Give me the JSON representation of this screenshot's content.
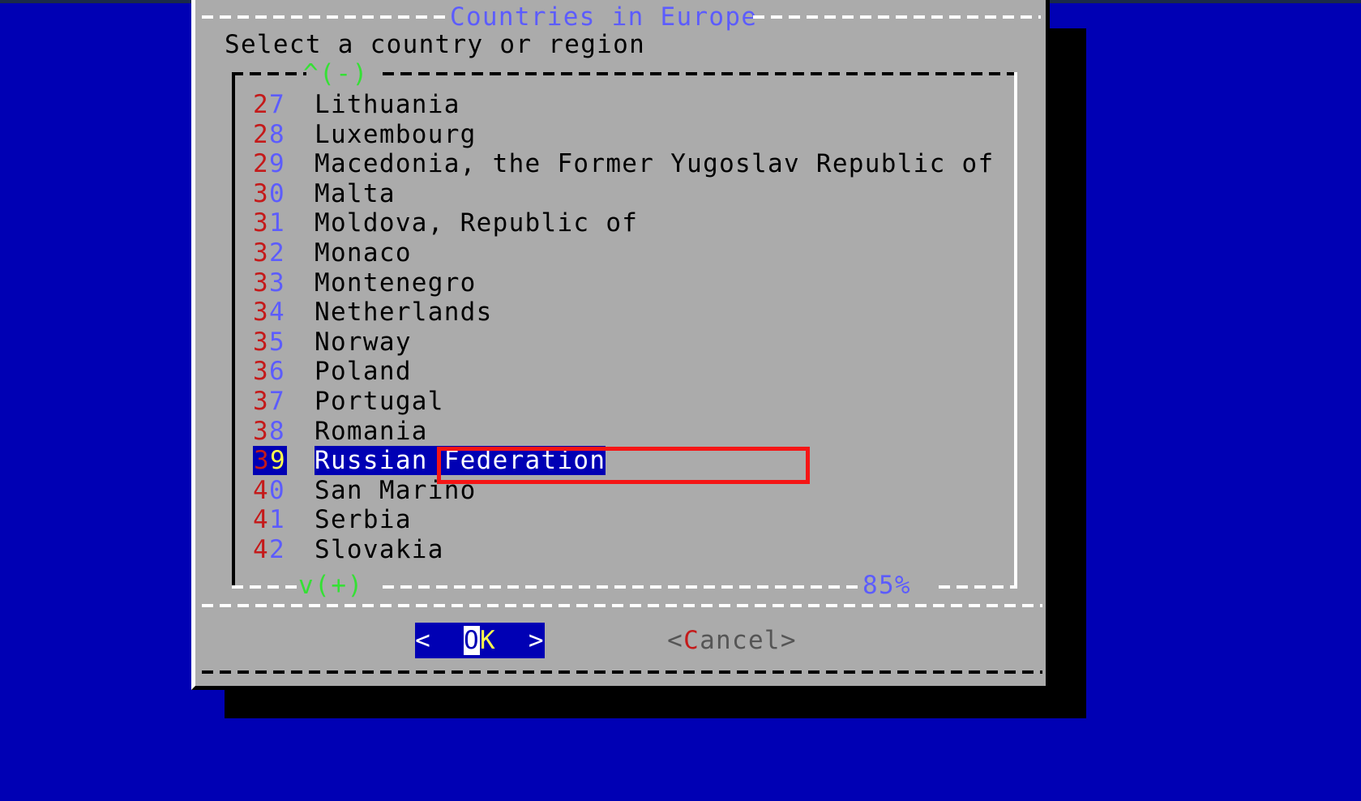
{
  "desktop": {
    "background_color": "#0000B4"
  },
  "dialog": {
    "title": "Countries in Europe",
    "prompt": "Select a country or region",
    "frame_color": "#ABABAB",
    "title_color": "#5C5CFF",
    "shadow_color": "#000000"
  },
  "listbox": {
    "scroll_up_indicator": "^(-)",
    "scroll_down_indicator": "v(+)",
    "scroll_percent": "85%",
    "scroll_percent_color": "#5C5CFF",
    "indicator_color": "#35E035",
    "rows": [
      {
        "num": "27",
        "d1": "2",
        "d2": "7",
        "name": "Lithuania",
        "selected": false
      },
      {
        "num": "28",
        "d1": "2",
        "d2": "8",
        "name": "Luxembourg",
        "selected": false
      },
      {
        "num": "29",
        "d1": "2",
        "d2": "9",
        "name": "Macedonia, the Former Yugoslav Republic of",
        "selected": false
      },
      {
        "num": "30",
        "d1": "3",
        "d2": "0",
        "name": "Malta",
        "selected": false
      },
      {
        "num": "31",
        "d1": "3",
        "d2": "1",
        "name": "Moldova, Republic of",
        "selected": false
      },
      {
        "num": "32",
        "d1": "3",
        "d2": "2",
        "name": "Monaco",
        "selected": false
      },
      {
        "num": "33",
        "d1": "3",
        "d2": "3",
        "name": "Montenegro",
        "selected": false
      },
      {
        "num": "34",
        "d1": "3",
        "d2": "4",
        "name": "Netherlands",
        "selected": false
      },
      {
        "num": "35",
        "d1": "3",
        "d2": "5",
        "name": "Norway",
        "selected": false
      },
      {
        "num": "36",
        "d1": "3",
        "d2": "6",
        "name": "Poland",
        "selected": false
      },
      {
        "num": "37",
        "d1": "3",
        "d2": "7",
        "name": "Portugal",
        "selected": false
      },
      {
        "num": "38",
        "d1": "3",
        "d2": "8",
        "name": "Romania",
        "selected": false
      },
      {
        "num": "39",
        "d1": "3",
        "d2": "9",
        "name": "Russian Federation",
        "selected": true
      },
      {
        "num": "40",
        "d1": "4",
        "d2": "0",
        "name": "San Marino",
        "selected": false
      },
      {
        "num": "41",
        "d1": "4",
        "d2": "1",
        "name": "Serbia",
        "selected": false
      },
      {
        "num": "42",
        "d1": "4",
        "d2": "2",
        "name": "Slovakia",
        "selected": false
      }
    ]
  },
  "annotation": {
    "target_row": "39 Russian Federation",
    "box_color": "#F51515"
  },
  "buttons": {
    "ok": {
      "left_bracket": "<",
      "lead_space": "  ",
      "cursor_char": "O",
      "hot_rest": "K",
      "trail_space": "  ",
      "right_bracket": ">",
      "label": "OK",
      "background": "#0000B4"
    },
    "cancel": {
      "left_bracket": "<",
      "hot": "C",
      "rest": "ancel",
      "right_bracket": ">",
      "label": "Cancel"
    }
  }
}
